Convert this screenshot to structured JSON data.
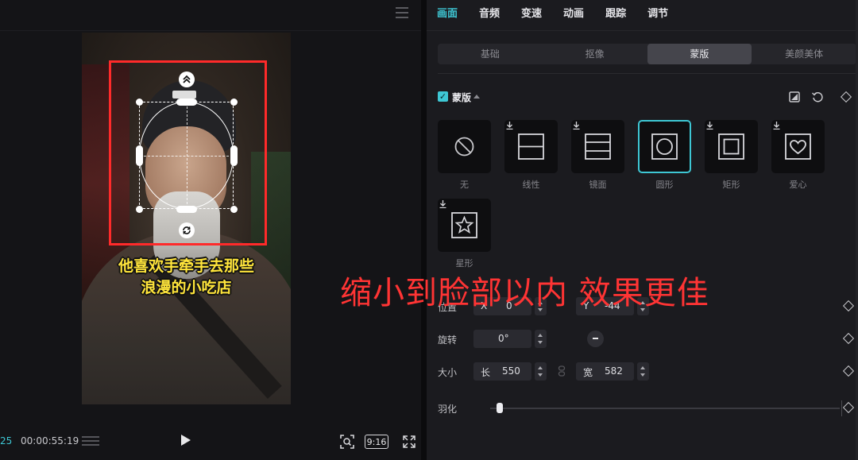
{
  "preview": {
    "subtitle_line1": "他喜欢手牵手去那些",
    "subtitle_line2": "浪漫的小吃店",
    "timecode_current": "25",
    "timecode_total": "00:00:55:19",
    "ratio_label": "9:16"
  },
  "inspector": {
    "main_tabs": [
      "画面",
      "音频",
      "变速",
      "动画",
      "跟踪",
      "调节"
    ],
    "active_main_tab": "画面",
    "sub_tabs": [
      "基础",
      "抠像",
      "蒙版",
      "美颜美体"
    ],
    "active_sub_tab": "蒙版",
    "mask_section": {
      "title": "蒙版",
      "enabled": true,
      "shapes": [
        {
          "label": "无",
          "icon": "none-icon"
        },
        {
          "label": "线性",
          "icon": "linear-mask-icon"
        },
        {
          "label": "镜面",
          "icon": "mirror-mask-icon"
        },
        {
          "label": "圆形",
          "icon": "circle-mask-icon"
        },
        {
          "label": "矩形",
          "icon": "rectangle-mask-icon"
        },
        {
          "label": "爱心",
          "icon": "heart-mask-icon"
        },
        {
          "label": "星形",
          "icon": "star-mask-icon"
        }
      ],
      "selected_shape": "圆形"
    },
    "properties": {
      "position": {
        "label": "位置",
        "x_prefix": "X",
        "x": "0",
        "y_prefix": "Y",
        "y": "-44"
      },
      "rotation": {
        "label": "旋转",
        "value": "0°"
      },
      "size": {
        "label": "大小",
        "w_prefix": "长",
        "w": "550",
        "h_prefix": "宽",
        "h": "582"
      },
      "feather": {
        "label": "羽化",
        "value_fraction": 0.0
      }
    }
  },
  "overlay_caption": "缩小到脸部以内   效果更佳",
  "colors": {
    "accent": "#3ec7d4",
    "annotation_red": "#ff2a2a",
    "subtitle_yellow": "#ffe53b"
  }
}
